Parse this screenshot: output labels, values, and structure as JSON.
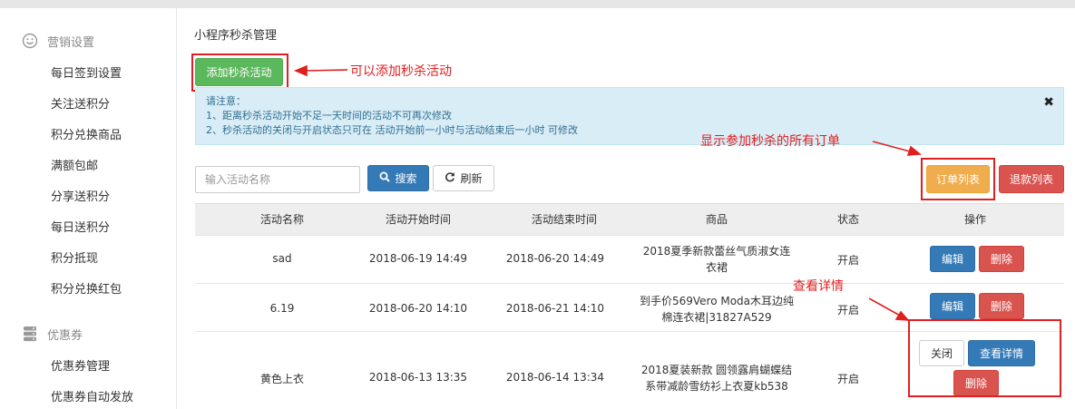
{
  "sidebar": {
    "group1": {
      "icon": "smile-icon",
      "label": "营销设置"
    },
    "items1": [
      {
        "label": "每日签到设置"
      },
      {
        "label": "关注送积分"
      },
      {
        "label": "积分兑换商品"
      },
      {
        "label": "满额包邮"
      },
      {
        "label": "分享送积分"
      },
      {
        "label": "每日送积分"
      },
      {
        "label": "积分抵现"
      },
      {
        "label": "积分兑换红包"
      }
    ],
    "group2": {
      "icon": "database-icon",
      "label": "优惠券"
    },
    "items2": [
      {
        "label": "优惠券管理"
      },
      {
        "label": "优惠券自动发放"
      }
    ]
  },
  "main": {
    "title": "小程序秒杀管理",
    "add_button": "添加秒杀活动",
    "notice": {
      "line1": "请注意：",
      "line2": "1、距离秒杀活动开始不足一天时间的活动不可再次修改",
      "line3": "2、秒杀活动的关闭与开启状态只可在 活动开始前一小时与活动结束后一小时 可修改",
      "close": "✖"
    },
    "search": {
      "placeholder": "输入活动名称",
      "search_label": "搜索",
      "refresh_label": "刷新"
    },
    "order_list_button": "订单列表",
    "refund_list_button": "退款列表"
  },
  "annotations": {
    "add": "可以添加秒杀活动",
    "orders": "显示参加秒杀的所有订单",
    "details": "查看详情"
  },
  "table": {
    "headers": [
      "活动名称",
      "活动开始时间",
      "活动结束时间",
      "商品",
      "状态",
      "操作"
    ],
    "rows": [
      {
        "name": "sad",
        "start": "2018-06-19 14:49",
        "end": "2018-06-20 14:49",
        "product_line1": "2018夏季新款蕾丝气质淑女连",
        "product_line2": "衣裙",
        "status": "开启"
      },
      {
        "name": "6.19",
        "start": "2018-06-20 14:10",
        "end": "2018-06-21 14:10",
        "product_line1": "到手价569Vero Moda木耳边纯",
        "product_line2": "棉连衣裙|31827A529",
        "status": "开启"
      },
      {
        "name": "黄色上衣",
        "start": "2018-06-13 13:35",
        "end": "2018-06-14 13:34",
        "product_line1": "2018夏装新款 圆领露肩蝴蝶结",
        "product_line2": "系带减龄雪纺衫上衣夏kb538",
        "status": "开启"
      }
    ],
    "actions": {
      "edit": "编辑",
      "delete": "删除",
      "close": "关闭",
      "details": "查看详情"
    }
  },
  "colors": {
    "annotation": "#e02020",
    "primary": "#337ab7",
    "danger": "#d9534f",
    "success": "#5cb85c",
    "warning": "#f0ad4e"
  }
}
